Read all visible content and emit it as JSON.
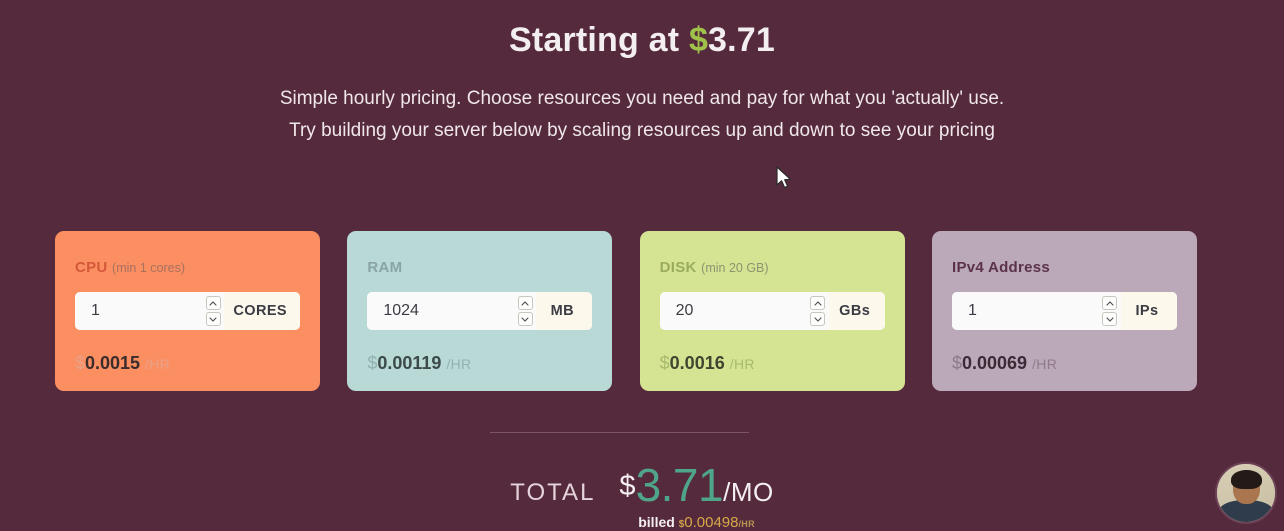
{
  "hero": {
    "title_prefix": "Starting at ",
    "title_currency": "$",
    "title_amount": "3.71",
    "subtitle_line1": "Simple hourly pricing. Choose resources you need and pay for what you 'actually' use.",
    "subtitle_line2": "Try building your server below by scaling resources up and down to see your pricing"
  },
  "cards": [
    {
      "id": "cpu",
      "label": "CPU",
      "min_note": "(min 1 cores)",
      "value": "1",
      "unit": "CORES",
      "price_currency": "$",
      "price_amount": "0.0015",
      "price_period": "/HR",
      "bg_color": "#fb8f62"
    },
    {
      "id": "ram",
      "label": "RAM",
      "min_note": "",
      "value": "1024",
      "unit": "MB",
      "price_currency": "$",
      "price_amount": "0.00119",
      "price_period": "/HR",
      "bg_color": "#b8d9d6"
    },
    {
      "id": "disk",
      "label": "DISK",
      "min_note": "(min 20 GB)",
      "value": "20",
      "unit": "GBs",
      "price_currency": "$",
      "price_amount": "0.0016",
      "price_period": "/HR",
      "bg_color": "#d5e493"
    },
    {
      "id": "ipv4",
      "label": "IPv4 Address",
      "min_note": "",
      "value": "1",
      "unit": "IPs",
      "price_currency": "$",
      "price_amount": "0.00069",
      "price_period": "/HR",
      "bg_color": "#bba8b8"
    }
  ],
  "total": {
    "label": "TOTAL",
    "currency": "$",
    "amount": "3.71",
    "period": "/MO",
    "billed_label": "billed",
    "billed_currency": "$",
    "billed_amount": "0.00498",
    "billed_period": "/HR"
  },
  "colors": {
    "page_bg": "#562a3d",
    "accent_green": "#9fc24a",
    "total_green": "#4fa58a",
    "billed_gold": "#d7a948"
  }
}
